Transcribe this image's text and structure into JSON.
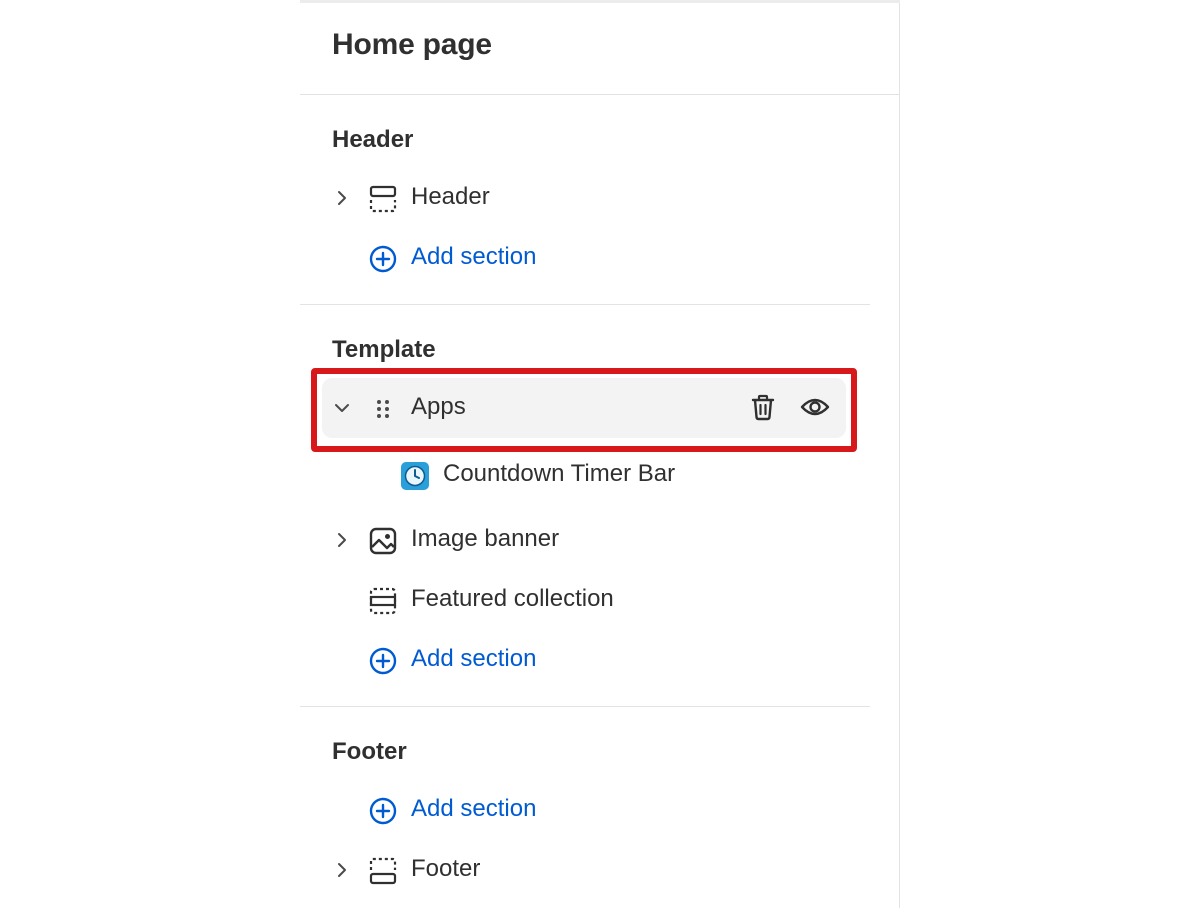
{
  "page": {
    "title": "Home page"
  },
  "groups": {
    "header": {
      "title": "Header",
      "items": [
        {
          "label": "Header",
          "icon": "header-layout-icon"
        }
      ],
      "add_label": "Add section"
    },
    "template": {
      "title": "Template",
      "selected": {
        "label": "Apps",
        "icon": "drag-handle-icon",
        "actions": [
          "trash-icon",
          "eye-icon"
        ],
        "child": {
          "label": "Countdown Timer Bar",
          "icon": "countdown-app-icon"
        }
      },
      "items": [
        {
          "label": "Image banner",
          "icon": "image-icon"
        },
        {
          "label": "Featured collection",
          "icon": "section-layout-icon"
        }
      ],
      "add_label": "Add section"
    },
    "footer": {
      "title": "Footer",
      "add_label": "Add section",
      "items": [
        {
          "label": "Footer",
          "icon": "footer-layout-icon"
        }
      ]
    }
  },
  "colors": {
    "link": "#005bd3",
    "highlight": "#d7191c",
    "selected_bg": "#f3f3f3",
    "app_icon": "#2b9fd9"
  }
}
